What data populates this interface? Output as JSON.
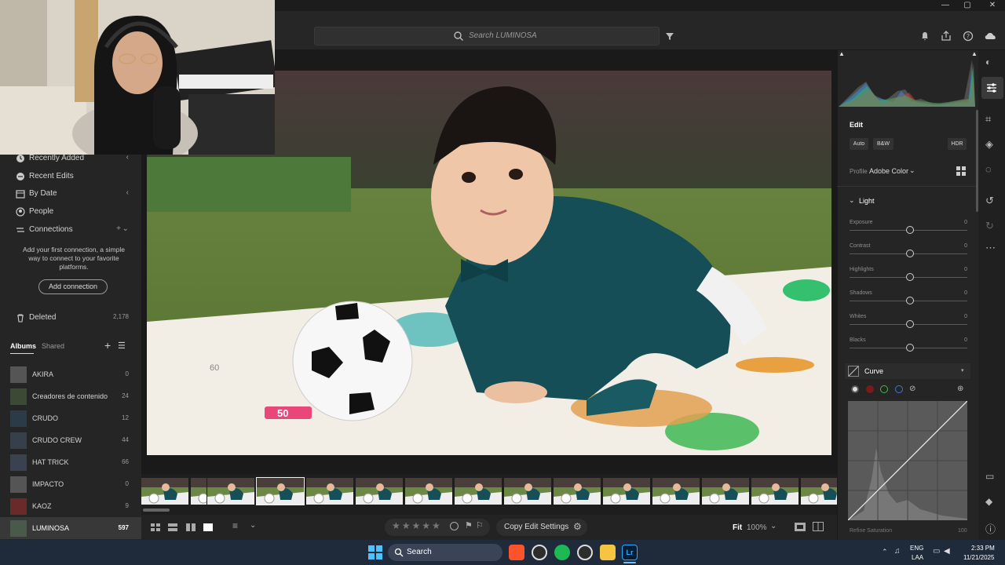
{
  "window": {
    "min": "—",
    "max": "▢",
    "close": "✕"
  },
  "search": {
    "placeholder": "Search LUMINOSA"
  },
  "sidebar": {
    "items": [
      {
        "label": "Recently Added"
      },
      {
        "label": "Recent Edits"
      },
      {
        "label": "By Date"
      },
      {
        "label": "People"
      },
      {
        "label": "Connections"
      }
    ],
    "connections_hint": "Add your first connection, a simple way to connect to your favorite platforms.",
    "add_connection": "Add connection",
    "deleted": {
      "label": "Deleted",
      "count": "2,178"
    },
    "tabs": {
      "albums": "Albums",
      "shared": "Shared"
    },
    "albums": [
      {
        "name": "AKIRA",
        "count": "0"
      },
      {
        "name": "Creadores de contenido",
        "count": "24"
      },
      {
        "name": "CRUDO",
        "count": "12"
      },
      {
        "name": "CRUDO CREW",
        "count": "44"
      },
      {
        "name": "HAT TRICK",
        "count": "66"
      },
      {
        "name": "IMPACTO",
        "count": "0"
      },
      {
        "name": "KAOZ",
        "count": "9"
      },
      {
        "name": "LUMINOSA",
        "count": "597"
      }
    ]
  },
  "photo_labels": {
    "n60": "60",
    "n50": "50"
  },
  "bottombar": {
    "copy_edit": "Copy Edit Settings",
    "fit": "Fit",
    "zoom": "100%"
  },
  "edit": {
    "title": "Edit",
    "auto": "Auto",
    "bw": "B&W",
    "hdr": "HDR",
    "profile_label": "Profile",
    "profile_value": "Adobe Color",
    "light": "Light",
    "sliders": [
      {
        "label": "Exposure",
        "value": "0"
      },
      {
        "label": "Contrast",
        "value": "0"
      },
      {
        "label": "Highlights",
        "value": "0"
      },
      {
        "label": "Shadows",
        "value": "0"
      },
      {
        "label": "Whites",
        "value": "0"
      },
      {
        "label": "Blacks",
        "value": "0"
      }
    ],
    "curve": "Curve",
    "refine": "Refine Saturation",
    "refine_value": "100"
  },
  "taskbar": {
    "search": "Search",
    "lang": "ENG",
    "region": "LAA",
    "time": "2:33 PM",
    "date": "11/21/2025"
  },
  "colors": {
    "accent": "#1473e6",
    "panel": "#252525",
    "taskbar": "#1f2a3a",
    "lr_blue": "#31a8ff"
  }
}
